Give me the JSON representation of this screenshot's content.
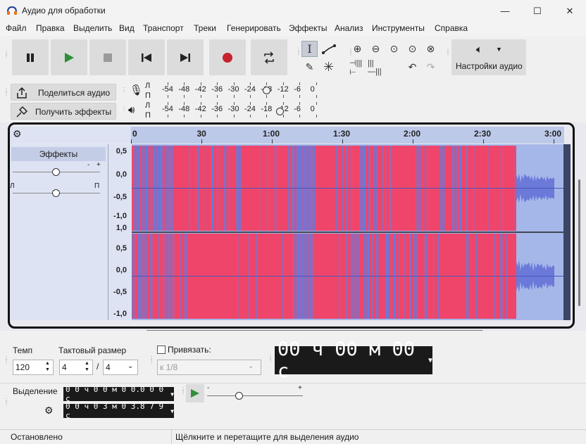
{
  "window": {
    "title": "Аудио для обработки",
    "controls": {
      "minimize": "—",
      "maximize": "☐",
      "close": "✕"
    }
  },
  "menu": [
    "Файл",
    "Правка",
    "Выделить",
    "Вид",
    "Транспорт",
    "Треки",
    "Генерировать",
    "Эффекты",
    "Анализ",
    "Инструменты",
    "Справка"
  ],
  "toolbar": {
    "transport": [
      "pause",
      "play",
      "stop",
      "skip-start",
      "skip-end",
      "record",
      "loop"
    ],
    "audio_settings_label": "Настройки аудио"
  },
  "side_buttons": {
    "share": "Поделиться аудио",
    "get_effects": "Получить эффекты"
  },
  "meters": {
    "record_channel_labels": [
      "Л",
      "П"
    ],
    "play_channel_labels": [
      "Л",
      "П"
    ],
    "scale": [
      "-54",
      "-48",
      "-42",
      "-36",
      "-30",
      "-24",
      "-18",
      "-12",
      "-6",
      "0"
    ]
  },
  "timeline": {
    "ticks": [
      "0",
      "30",
      "1:00",
      "1:30",
      "2:00",
      "2:30",
      "3:00"
    ]
  },
  "track": {
    "effects_label": "Эффекты",
    "gain_minus": "-",
    "gain_plus": "+",
    "pan_left": "Л",
    "pan_right": "П",
    "top_scale": [
      "0,5",
      "0,0",
      "-0,5",
      "-1,0"
    ],
    "bottom_scale": [
      "1,0",
      "0,5",
      "0,0",
      "-0,5",
      "-1,0"
    ],
    "colors": {
      "clipping": "#f0456a",
      "wave": "#6b79d9",
      "background": "#a5b6e8"
    }
  },
  "bottom": {
    "tempo_label": "Темп",
    "tempo_value": "120",
    "meter_label": "Тактовый размер",
    "meter_num": "4",
    "meter_den": "4",
    "snap_label": "Привязать:",
    "snap_value": "к 1/8",
    "big_time": "00 ч 00 м 00 с",
    "selection_label": "Выделение",
    "sel_start": "0 0 ч 0 0 м 0 0.0 0 0 с",
    "sel_end": "0 0 ч 0 3 м 0 3.8 7 9 с",
    "speed_minus": "-",
    "speed_plus": "+"
  },
  "status": {
    "left": "Остановлено",
    "right": "Щёлкните и перетащите для выделения аудио"
  }
}
